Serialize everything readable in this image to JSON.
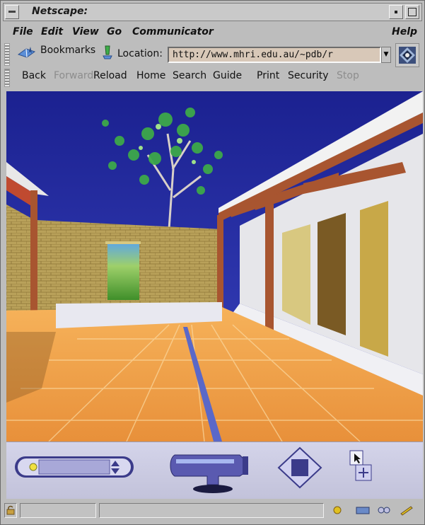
{
  "window": {
    "title": "Netscape:"
  },
  "menu": {
    "file": "File",
    "edit": "Edit",
    "view": "View",
    "go": "Go",
    "communicator": "Communicator",
    "help": "Help"
  },
  "location_bar": {
    "bookmarks_label": "Bookmarks",
    "location_label": "Location:",
    "url": "http://www.mhri.edu.au/~pdb/r"
  },
  "toolbar": {
    "back": "Back",
    "forward": "Forward",
    "reload": "Reload",
    "home": "Home",
    "search": "Search",
    "guide": "Guide",
    "print": "Print",
    "security": "Security",
    "stop": "Stop"
  },
  "status_bar": {
    "text": ""
  },
  "colors": {
    "chrome": "#bdbdbd",
    "url_field": "#d8c8b8",
    "sky": "#2a2fa0",
    "floor": "#f0a24a",
    "wall": "#b9a15a",
    "control_panel": "#c8c8e0"
  },
  "icons": [
    "window-menu-icon",
    "minimize-icon",
    "maximize-icon",
    "bookmarks-icon",
    "location-icon",
    "netscape-logo-icon",
    "security-lock-icon",
    "component-icons"
  ]
}
